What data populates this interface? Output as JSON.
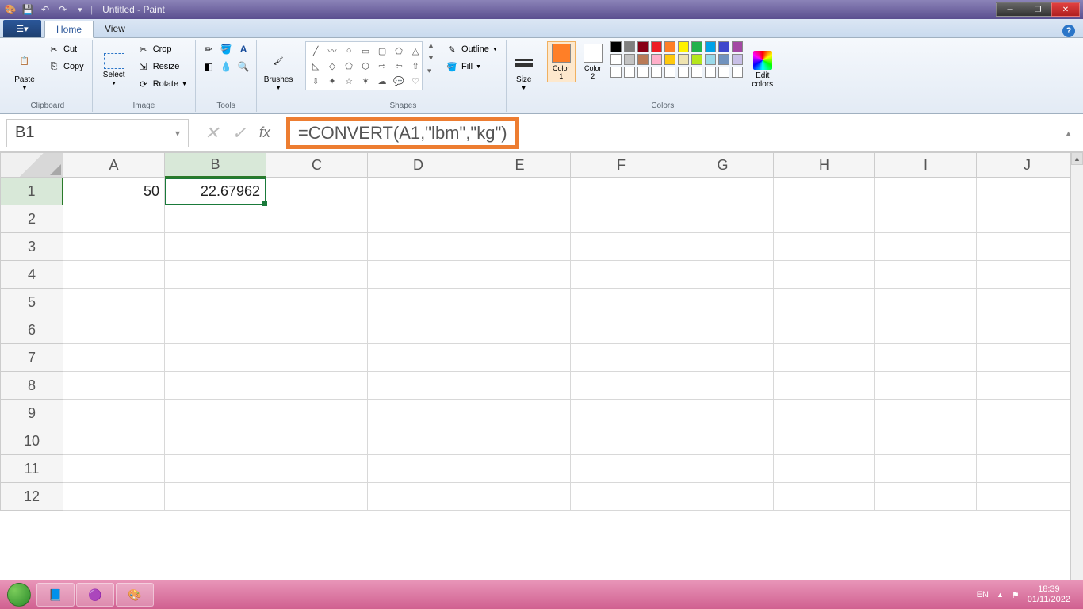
{
  "titlebar": {
    "title": "Untitled - Paint"
  },
  "ribbon_tabs": {
    "file": "",
    "home": "Home",
    "view": "View"
  },
  "ribbon": {
    "clipboard": {
      "label": "Clipboard",
      "paste": "Paste",
      "cut": "Cut",
      "copy": "Copy"
    },
    "image": {
      "label": "Image",
      "select": "Select",
      "crop": "Crop",
      "resize": "Resize",
      "rotate": "Rotate"
    },
    "tools": {
      "label": "Tools"
    },
    "brushes": {
      "label": "Brushes",
      "btn": "Brushes"
    },
    "shapes": {
      "label": "Shapes",
      "outline": "Outline",
      "fill": "Fill"
    },
    "size": {
      "label": "Size",
      "btn": "Size"
    },
    "colors": {
      "label": "Colors",
      "color1": "Color\n1",
      "color2": "Color\n2",
      "edit": "Edit\ncolors"
    },
    "palette": [
      "#000000",
      "#7f7f7f",
      "#880015",
      "#ed1c24",
      "#ff7f27",
      "#fff200",
      "#22b14c",
      "#00a2e8",
      "#3f48cc",
      "#a349a4",
      "#ffffff",
      "#c3c3c3",
      "#b97a57",
      "#ffaec9",
      "#ffc90e",
      "#efe4b0",
      "#b5e61d",
      "#99d9ea",
      "#7092be",
      "#c8bfe7",
      "#ffffff",
      "#ffffff",
      "#ffffff",
      "#ffffff",
      "#ffffff",
      "#ffffff",
      "#ffffff",
      "#ffffff",
      "#ffffff",
      "#ffffff"
    ],
    "color1_value": "#ff7f27",
    "color2_value": "#ffffff"
  },
  "formula_bar": {
    "name_box": "B1",
    "formula": "=CONVERT(A1,\"lbm\",\"kg\")"
  },
  "spreadsheet": {
    "columns": [
      "A",
      "B",
      "C",
      "D",
      "E",
      "F",
      "G",
      "H",
      "I",
      "J"
    ],
    "rows": [
      "1",
      "2",
      "3",
      "4",
      "5",
      "6",
      "7",
      "8",
      "9",
      "10",
      "11",
      "12"
    ],
    "cells": {
      "A1": "50",
      "B1": "22.67962"
    },
    "active_cell": "B1"
  },
  "taskbar": {
    "lang": "EN",
    "time": "18:39",
    "date": "01/11/2022"
  }
}
